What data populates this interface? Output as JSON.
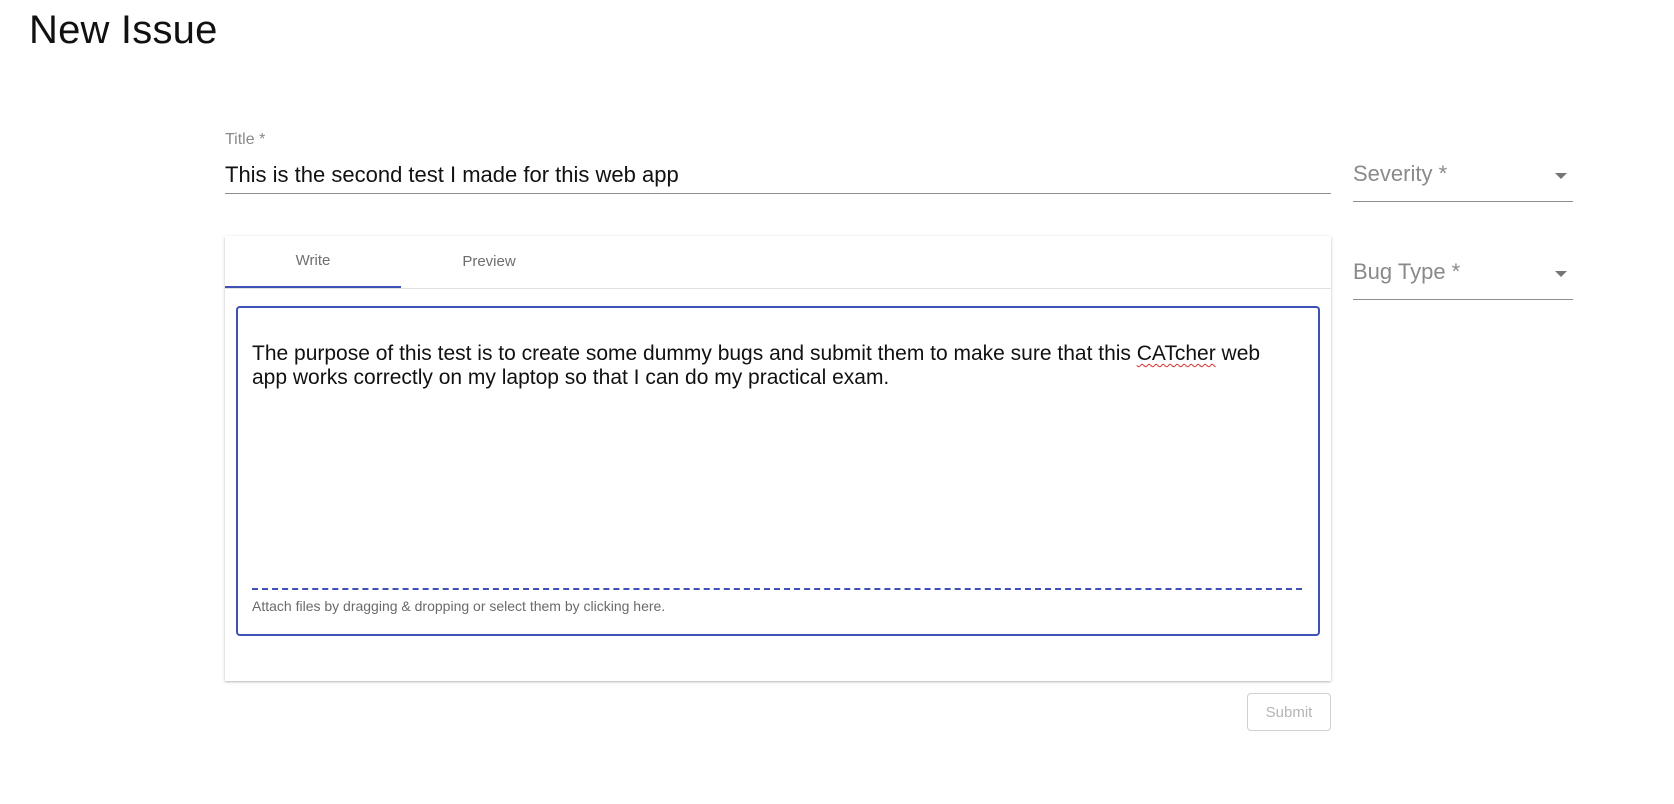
{
  "page": {
    "title": "New Issue"
  },
  "title_field": {
    "label": "Title *",
    "value": "This is the second test I made for this web app"
  },
  "severity_select": {
    "placeholder": "Severity *"
  },
  "bug_type_select": {
    "placeholder": "Bug Type *"
  },
  "editor": {
    "tabs": [
      {
        "label": "Write",
        "active": true
      },
      {
        "label": "Preview",
        "active": false
      }
    ],
    "text_before": "The purpose of this test is to create some dummy bugs and submit them to make sure that this ",
    "misspelled_word": "CATcher",
    "text_after": " web app works correctly on my laptop so that I can do my practical exam.",
    "attach_hint": "Attach files by dragging & dropping or select them by clicking here."
  },
  "actions": {
    "submit_label": "Submit",
    "submit_disabled": true
  },
  "colors": {
    "accent": "#3f51b5",
    "spellcheck_underline": "#d32f2f"
  }
}
